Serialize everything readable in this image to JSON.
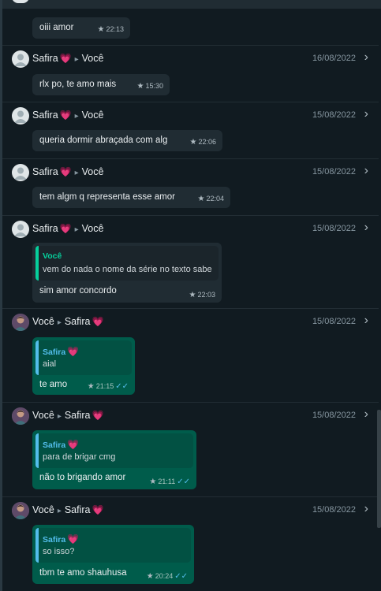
{
  "groups": [
    {
      "messages": [
        {
          "text": "oiii amor",
          "time": "22:13"
        }
      ]
    },
    {
      "sender": "Safira",
      "recipient": "Você",
      "date": "16/08/2022",
      "message": {
        "text": "rlx po, te amo mais",
        "time": "15:30"
      }
    },
    {
      "sender": "Safira",
      "recipient": "Você",
      "date": "15/08/2022",
      "message": {
        "text": "queria dormir abraçada com alg",
        "time": "22:06"
      }
    },
    {
      "sender": "Safira",
      "recipient": "Você",
      "date": "15/08/2022",
      "message": {
        "text": "tem algm q representa esse amor",
        "time": "22:04"
      }
    },
    {
      "sender": "Safira",
      "recipient": "Você",
      "date": "15/08/2022",
      "message": {
        "quoted_name": "Você",
        "quoted_text": "vem do nada o nome da série no texto sabe",
        "text": "sim amor concordo",
        "time": "22:03"
      }
    },
    {
      "sender": "Você",
      "recipient": "Safira",
      "date": "15/08/2022",
      "message": {
        "quoted_name": "Safira",
        "quoted_text": "aial",
        "text": "te amo",
        "time": "21:15"
      }
    },
    {
      "sender": "Você",
      "recipient": "Safira",
      "date": "15/08/2022",
      "message": {
        "quoted_name": "Safira",
        "quoted_text": "para de brigar cmg",
        "text": "não to brigando amor",
        "time": "21:11"
      }
    },
    {
      "sender": "Você",
      "recipient": "Safira",
      "date": "15/08/2022",
      "message": {
        "quoted_name": "Safira",
        "quoted_text": "so isso?",
        "text": "tbm te amo shauhusa",
        "time": "20:24"
      }
    }
  ],
  "icons": {
    "heart": "💗",
    "star": "★",
    "read_check": "✓✓",
    "chevron": "›"
  },
  "colors": {
    "incoming_bubble": "#202c33",
    "outgoing_bubble": "#005c4b",
    "quote_you": "#06cf9c",
    "quote_safira": "#53bdeb",
    "background": "#111b21"
  }
}
